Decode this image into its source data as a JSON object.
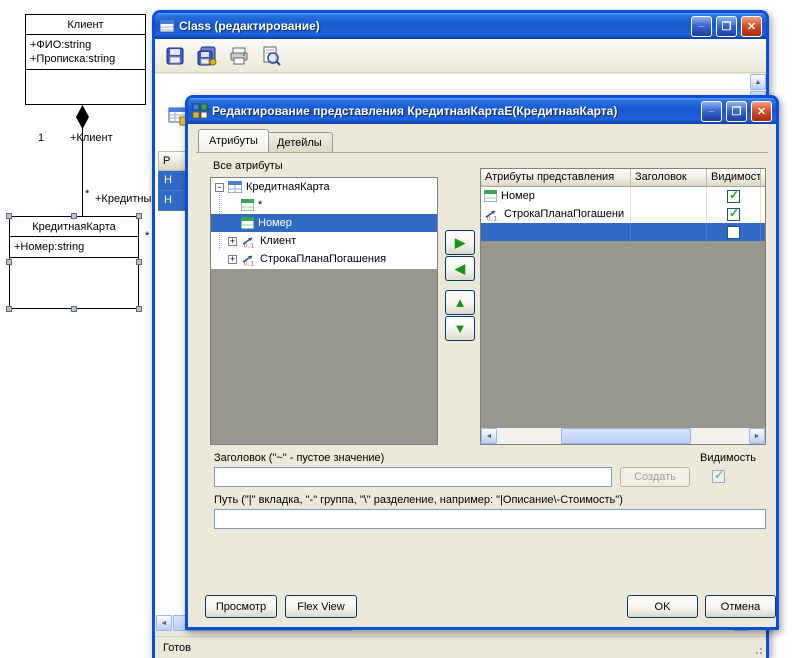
{
  "colors": {
    "selection_blue": "#316ac5",
    "titlebar_blue": "#1557cf",
    "dialog_bg": "#ece9d8"
  },
  "uml": {
    "client_class": {
      "title": "Клиент",
      "attributes": [
        "+ФИО:string",
        "+Прописка:string"
      ]
    },
    "card_class": {
      "title": "КредитнаяКарта",
      "attributes": [
        "+Номер:string"
      ]
    },
    "edge_labels": {
      "mult_one": "1",
      "role_client": "+Клиент",
      "mult_many": "*",
      "role_credit": "+Кредитны",
      "card_mult": "*"
    }
  },
  "window": {
    "title": "Class (редактирование)",
    "status": "Готов",
    "back_grid": {
      "header": "Р",
      "rows": [
        "Н",
        "Н"
      ]
    }
  },
  "dialog": {
    "title": "Редактирование представления КредитнаяКартаЕ(КредитнаяКарта)",
    "tabs": {
      "attributes": "Атрибуты",
      "details": "Детейлы"
    },
    "all_attributes_label": "Все атрибуты",
    "tree": [
      {
        "label": "КредитнаяКарта",
        "expander": "-",
        "icon": "table-icon",
        "selected": false
      },
      {
        "label": "*",
        "expander": "",
        "icon": "attribute-icon",
        "selected": false
      },
      {
        "label": "Номер",
        "expander": "",
        "icon": "attribute-icon",
        "selected": true
      },
      {
        "label": "Клиент",
        "expander": "+",
        "icon": "relation-icon",
        "selected": false
      },
      {
        "label": "СтрокаПланаПогашения",
        "expander": "+",
        "icon": "relation-icon",
        "selected": false
      }
    ],
    "grid": {
      "columns": [
        "Атрибуты представления",
        "Заголовок",
        "Видимость"
      ],
      "rows": [
        {
          "name": "Номер",
          "header": "",
          "visible": true,
          "selected": false
        },
        {
          "name": "СтрокаПланаПогашени",
          "header": "",
          "visible": true,
          "selected": false
        },
        {
          "name": "",
          "header": "",
          "visible": false,
          "selected": true
        }
      ]
    },
    "header_section": {
      "label": "Заголовок (\"~\" - пустое значение)",
      "input_value": "",
      "create_button": "Создать",
      "visibility_label": "Видимость",
      "visibility_checked": true
    },
    "path_section": {
      "label": "Путь (\"|\" вкладка, \"-\" группа, \"\\\" разделение, например: \"|Описание\\-Стоимость\")",
      "input_value": ""
    },
    "buttons": {
      "preview": "Просмотр",
      "flex_view": "Flex View",
      "ok": "OK",
      "cancel": "Отмена"
    }
  }
}
